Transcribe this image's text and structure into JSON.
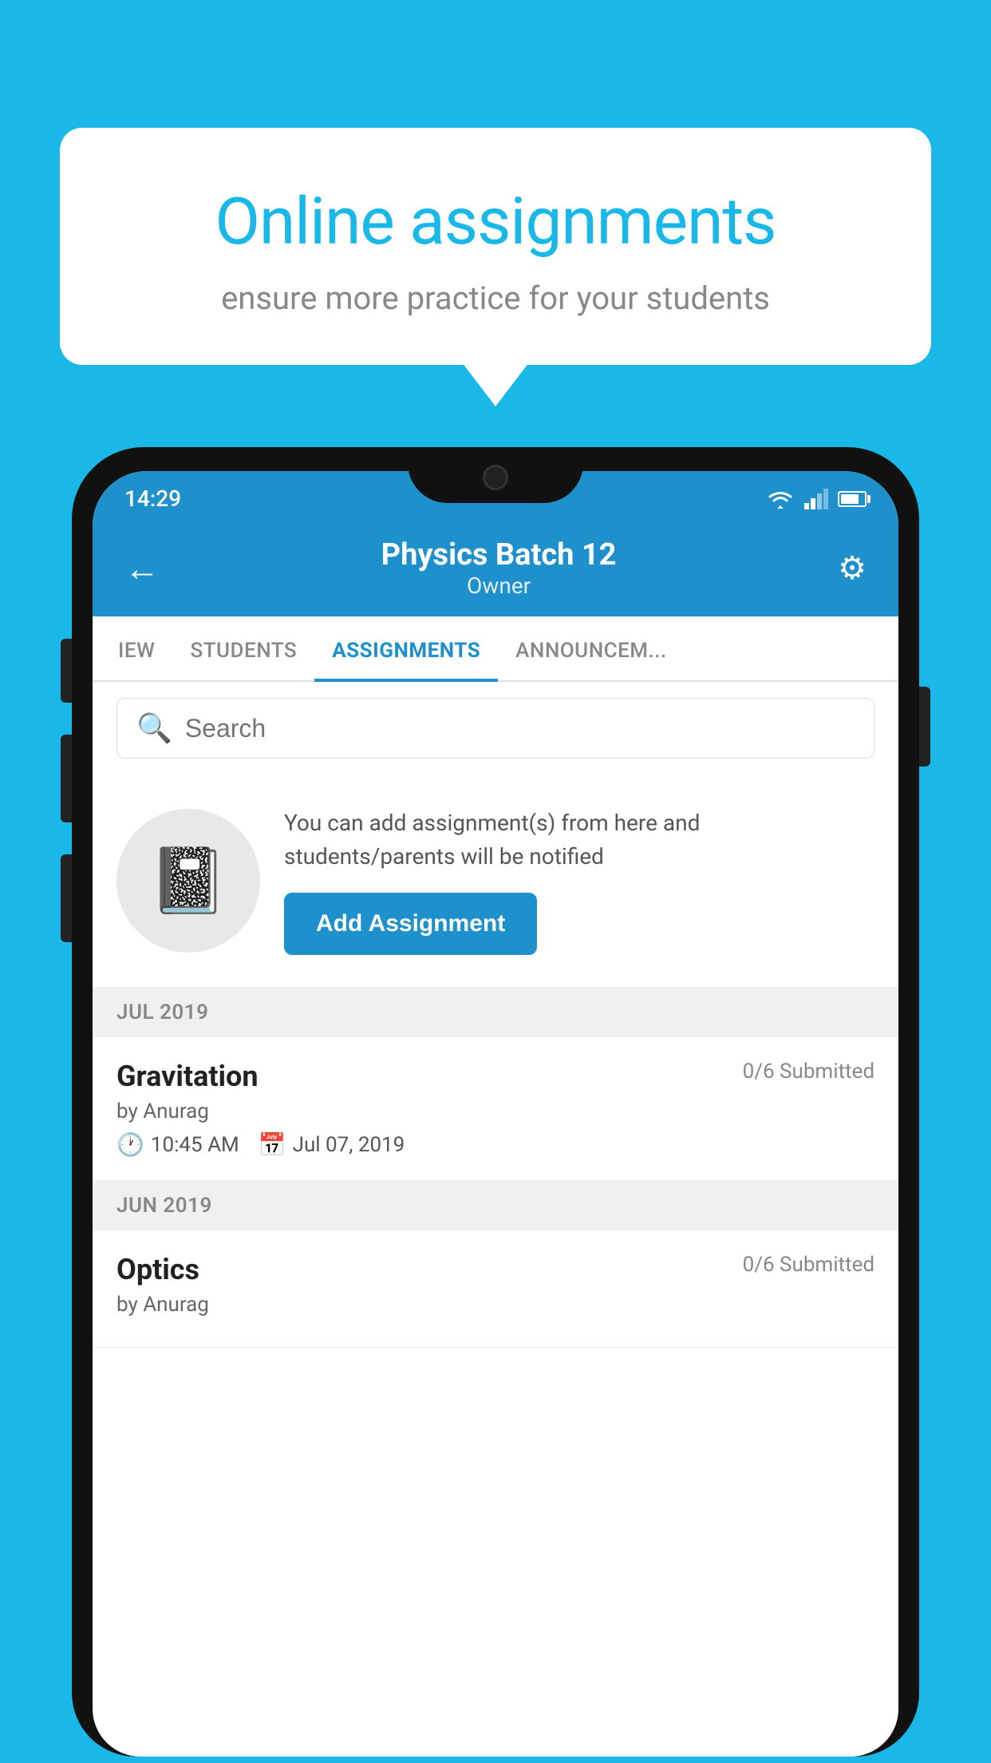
{
  "background_color": "#1ab8e8",
  "speech_bubble": {
    "title": "Online assignments",
    "subtitle": "ensure more practice for your students"
  },
  "status_bar": {
    "time": "14:29",
    "icons": [
      "wifi",
      "signal",
      "battery"
    ]
  },
  "app_header": {
    "title": "Physics Batch 12",
    "subtitle": "Owner",
    "back_label": "←",
    "settings_label": "⚙"
  },
  "tabs": [
    {
      "label": "IEW",
      "active": false
    },
    {
      "label": "STUDENTS",
      "active": false
    },
    {
      "label": "ASSIGNMENTS",
      "active": true
    },
    {
      "label": "ANNOUNCEM...",
      "active": false
    }
  ],
  "search": {
    "placeholder": "Search"
  },
  "info_section": {
    "description": "You can add assignment(s) from here and students/parents will be notified",
    "button_label": "Add Assignment"
  },
  "assignments": [
    {
      "month": "JUL 2019",
      "items": [
        {
          "title": "Gravitation",
          "submitted": "0/6 Submitted",
          "author": "by Anurag",
          "time": "10:45 AM",
          "date": "Jul 07, 2019"
        }
      ]
    },
    {
      "month": "JUN 2019",
      "items": [
        {
          "title": "Optics",
          "submitted": "0/6 Submitted",
          "author": "by Anurag",
          "time": "",
          "date": ""
        }
      ]
    }
  ]
}
